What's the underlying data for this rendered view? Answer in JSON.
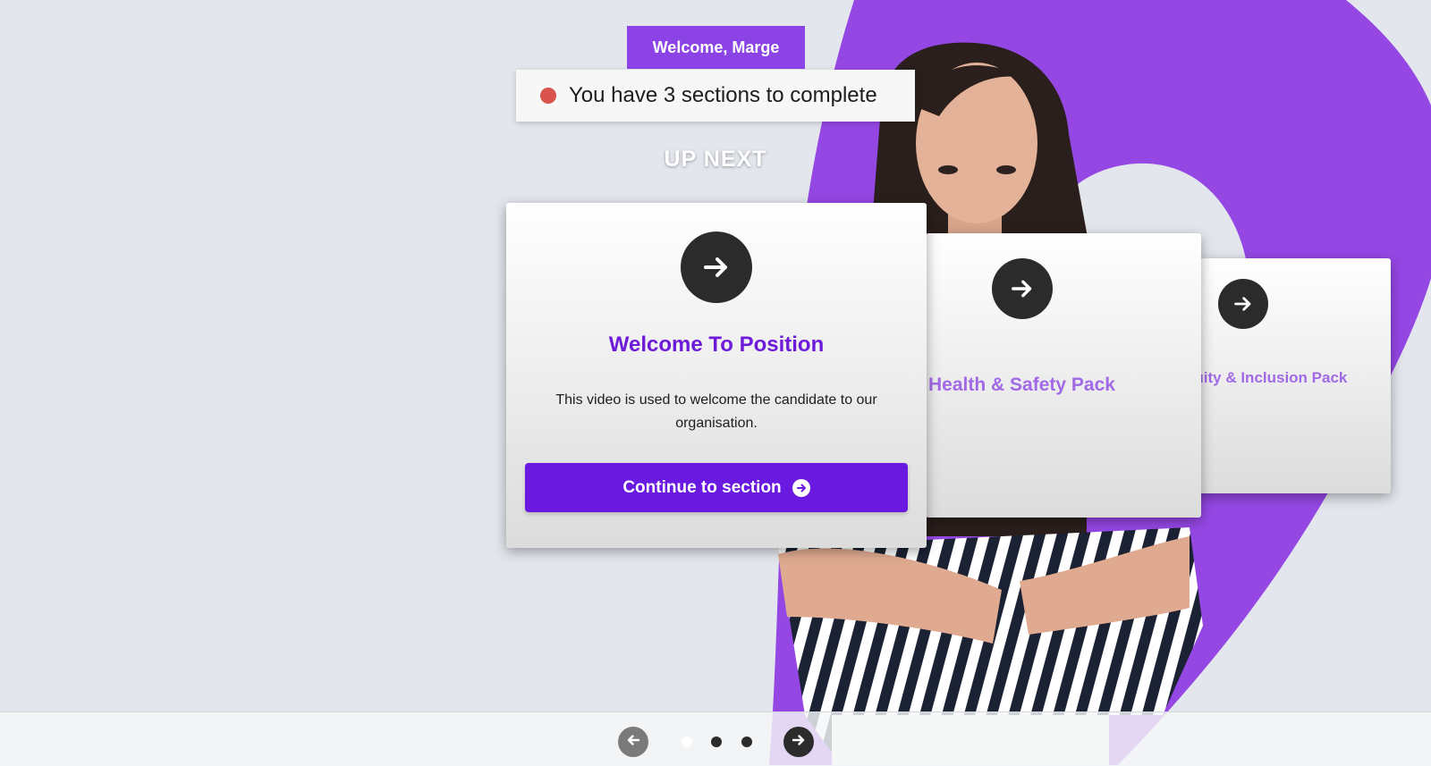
{
  "header": {
    "welcome": "Welcome, Marge",
    "status_text": "You have 3 sections to complete",
    "up_next": "UP NEXT"
  },
  "cards": [
    {
      "title": "Welcome To Position",
      "description": "This video is used to welcome the candidate to our organisation.",
      "button_label": "Continue to section",
      "icon": "arrow-right-icon"
    },
    {
      "title": "Health & Safety Pack",
      "icon": "arrow-right-icon"
    },
    {
      "title": "quity & Inclusion Pack",
      "icon": "arrow-right-icon"
    }
  ],
  "pagination": {
    "prev_icon": "arrow-left-icon",
    "next_icon": "arrow-right-icon",
    "active_index": 1,
    "total": 3
  },
  "colors": {
    "brand_purple": "#8c43e6",
    "button_purple": "#6a19e0",
    "title_purple": "#6d1ad9",
    "status_dot": "#d9534f"
  }
}
